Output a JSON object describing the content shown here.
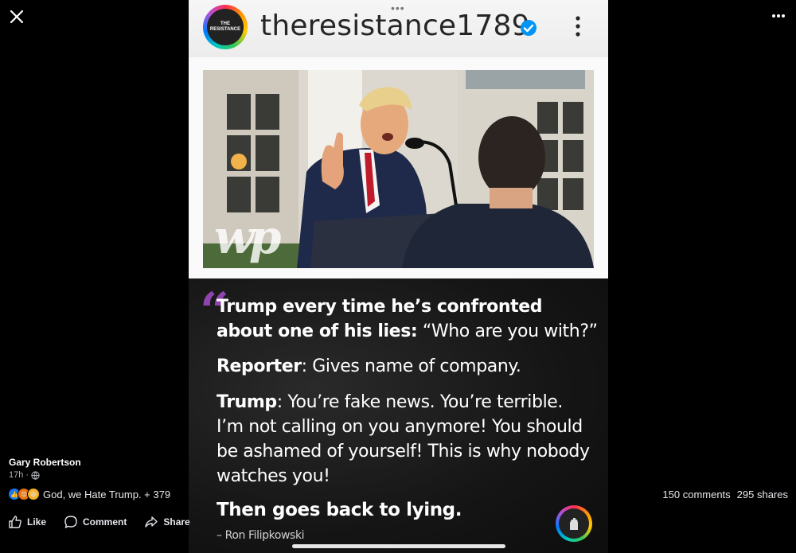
{
  "post": {
    "author": "Gary Robertson",
    "time": "17h",
    "reactions_text": "God, we Hate Trump. + 379",
    "comments": "150 comments",
    "shares": "295 shares",
    "actions": {
      "like": "Like",
      "comment": "Comment",
      "share": "Share"
    }
  },
  "media": {
    "ig_username": "theresistance1789",
    "avatar_text": "THE RESISTANCE",
    "photo_watermark": "wp",
    "quote": {
      "line1_bold": "Trump every time he’s confronted about one of his lies:",
      "line1_rest": " “Who are you with?”",
      "reporter_label": "Reporter",
      "reporter_text": ": Gives name of company.",
      "trump_label": "Trump",
      "trump_text": ": You’re fake news. You’re terrible. I’m not calling on you anymore! You should be ashamed of yourself! This is why nobody watches you!",
      "closing": "Then goes back to lying.",
      "attribution": "– Ron Filipkowski"
    }
  },
  "icons": {
    "close": "close-icon",
    "more": "more-horizontal-icon",
    "verified": "verified-badge-icon",
    "globe": "globe-icon",
    "like": "thumbs-up-icon",
    "comment": "comment-bubble-icon",
    "share": "share-arrow-icon"
  },
  "colors": {
    "background": "#000000",
    "accent_verified": "#0095f6",
    "quote_mark": "#8e44ad",
    "like_blue": "#1877f2"
  }
}
